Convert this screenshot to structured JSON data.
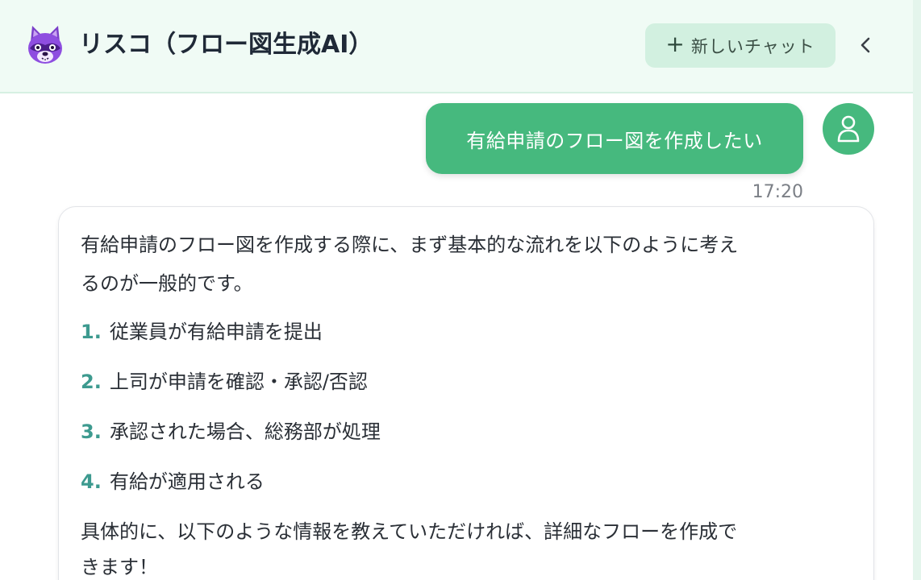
{
  "header": {
    "title": "リスコ（フロー図生成AI）",
    "new_chat_label": "新しいチャット",
    "logo_icon": "raccoon-mascot-icon",
    "collapse_icon": "chevron-left-icon"
  },
  "messages": {
    "user": {
      "text": "有給申請のフロー図を作成したい",
      "time": "17:20"
    },
    "assistant": {
      "intro_line1": "有給申請のフロー図を作成する際に、まず基本的な流れを以下のように考え",
      "intro_line2": "るのが一般的です。",
      "steps": [
        {
          "num": "1.",
          "text": "従業員が有給申請を提出"
        },
        {
          "num": "2.",
          "text": "上司が申請を確認・承認/否認"
        },
        {
          "num": "3.",
          "text": "承認された場合、総務部が処理"
        },
        {
          "num": "4.",
          "text": "有給が適用される"
        }
      ],
      "outro_line1": "具体的に、以下のような情報を教えていただければ、詳細なフローを作成で",
      "outro_line2": "きます！"
    }
  },
  "colors": {
    "accent": "#46b97e",
    "header_bg": "#f0fbf5",
    "new_chat_bg": "#d2f0e0",
    "list_number": "#3d9a8f"
  }
}
